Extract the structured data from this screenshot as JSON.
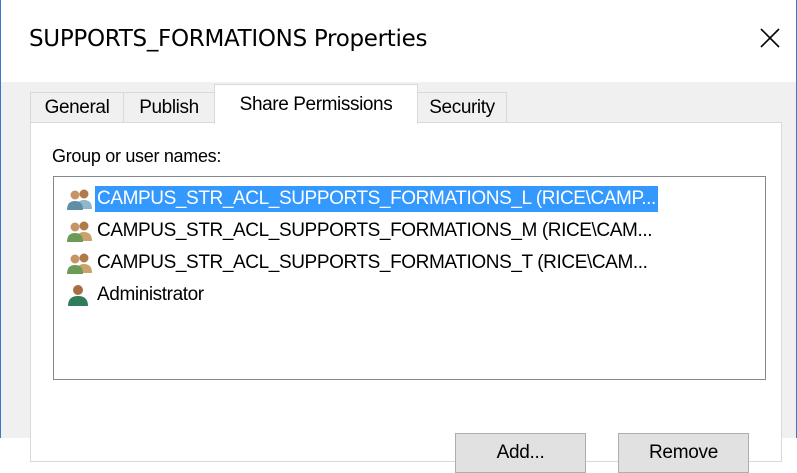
{
  "window": {
    "title": "SUPPORTS_FORMATIONS Properties"
  },
  "tabs": [
    {
      "label": "General"
    },
    {
      "label": "Publish"
    },
    {
      "label": "Share Permissions"
    },
    {
      "label": "Security"
    }
  ],
  "active_tab": "Share Permissions",
  "share_permissions": {
    "group_label": "Group or user names:",
    "users": [
      {
        "name": "CAMPUS_STR_ACL_SUPPORTS_FORMATIONS_L (RICE\\CAMP...",
        "icon": "group-users-icon",
        "selected": true
      },
      {
        "name": "CAMPUS_STR_ACL_SUPPORTS_FORMATIONS_M (RICE\\CAM...",
        "icon": "group-users-icon",
        "selected": false
      },
      {
        "name": "CAMPUS_STR_ACL_SUPPORTS_FORMATIONS_T (RICE\\CAM...",
        "icon": "group-users-icon",
        "selected": false
      },
      {
        "name": "Administrator",
        "icon": "user-icon",
        "selected": false
      }
    ],
    "buttons": {
      "add": "Add...",
      "remove": "Remove"
    }
  },
  "colors": {
    "selection": "#3399ff",
    "window_border": "#3b78c7",
    "client_bg": "#f0f0f0"
  }
}
